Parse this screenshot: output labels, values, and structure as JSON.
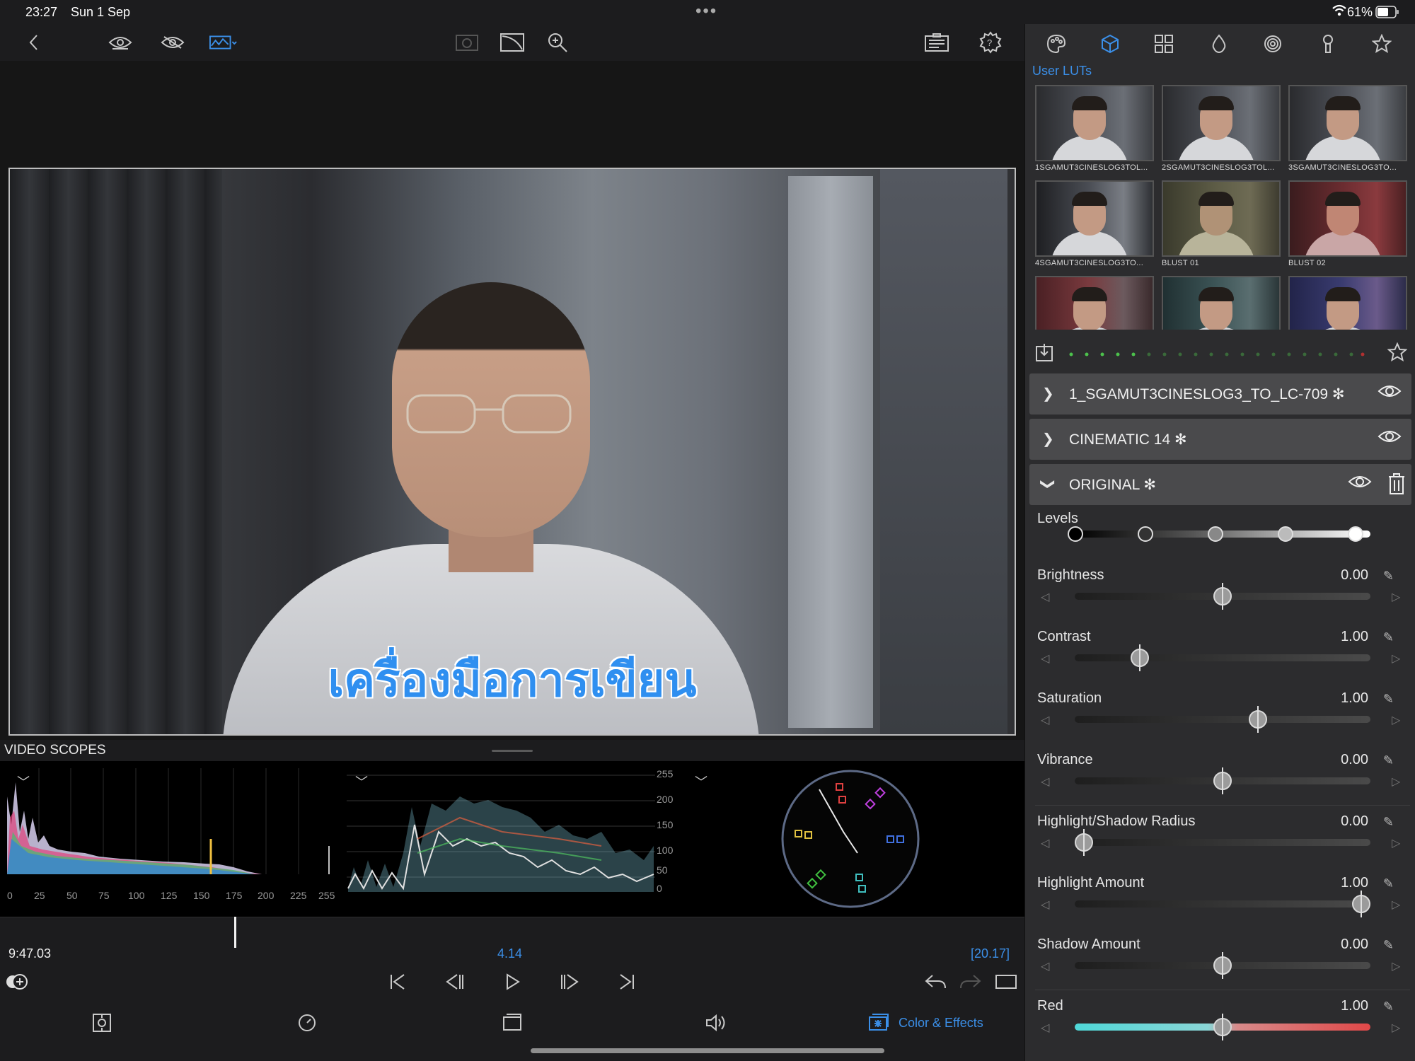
{
  "status_bar": {
    "time": "23:27",
    "date": "Sun 1 Sep",
    "battery": "61%"
  },
  "video": {
    "caption": "เครื่องมือการเขียน"
  },
  "scopes": {
    "title": "VIDEO SCOPES",
    "histogram_ticks": [
      "0",
      "25",
      "50",
      "75",
      "100",
      "125",
      "150",
      "175",
      "200",
      "225",
      "255"
    ],
    "waveform_ticks": [
      "255",
      "200",
      "150",
      "100",
      "50",
      "0"
    ]
  },
  "timeline": {
    "current_time": "9:47.03",
    "clip_time": "4.14",
    "total_time": "[20.17]"
  },
  "bottom_tabs": {
    "color_effects_label": "Color & Effects"
  },
  "panel": {
    "section_title": "User LUTs",
    "luts": [
      {
        "name": "1SGAMUT3CINESLOG3TOL..."
      },
      {
        "name": "2SGAMUT3CINESLOG3TOL..."
      },
      {
        "name": "3SGAMUT3CINESLOG3TO..."
      },
      {
        "name": "4SGAMUT3CINESLOG3TO..."
      },
      {
        "name": "BLUST 01"
      },
      {
        "name": "BLUST 02"
      }
    ],
    "layers": [
      {
        "name": "1_SGAMUT3CINESLOG3_TO_LC-709 ✻"
      },
      {
        "name": "CINEMATIC 14 ✻"
      },
      {
        "name": "ORIGINAL ✻"
      }
    ],
    "levels_label": "Levels",
    "adjustments": [
      {
        "label": "Brightness",
        "value": "0.00",
        "position": 0.5
      },
      {
        "label": "Contrast",
        "value": "1.00",
        "position": 0.22
      },
      {
        "label": "Saturation",
        "value": "1.00",
        "position": 0.62
      },
      {
        "label": "Vibrance",
        "value": "0.00",
        "position": 0.5
      },
      {
        "label": "Highlight/Shadow Radius",
        "value": "0.00",
        "position": 0.03
      },
      {
        "label": "Highlight Amount",
        "value": "1.00",
        "position": 0.97
      },
      {
        "label": "Shadow Amount",
        "value": "0.00",
        "position": 0.5
      },
      {
        "label": "Red",
        "value": "1.00",
        "position": 0.5
      }
    ]
  },
  "colors": {
    "accent": "#3b8fe8",
    "panel_bg": "#2c2c2e",
    "layer_bg": "#4a4a4c"
  }
}
